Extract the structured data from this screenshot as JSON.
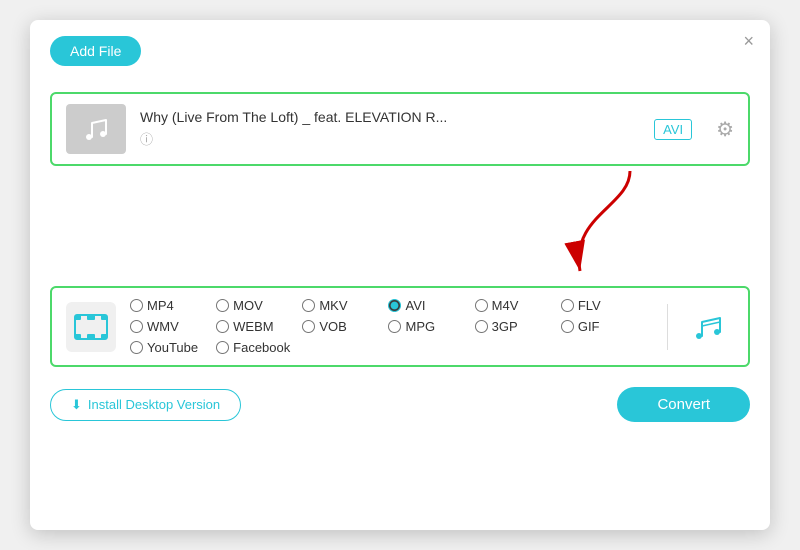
{
  "dialog": {
    "close_label": "×",
    "add_file_label": "Add File",
    "install_label": "Install Desktop Version",
    "convert_label": "Convert"
  },
  "file": {
    "title": "Why (Live From The Loft) _ feat. ELEVATION R...",
    "format": "AVI"
  },
  "formats": {
    "row1": [
      "MP4",
      "MOV",
      "MKV",
      "AVI",
      "M4V",
      "FLV",
      "WMV"
    ],
    "row2": [
      "WEBM",
      "VOB",
      "MPG",
      "3GP",
      "GIF",
      "YouTube",
      "Facebook"
    ],
    "selected": "AVI"
  },
  "icons": {
    "music_note": "♪",
    "gear": "⚙",
    "info": "ⓘ",
    "download": "⬇",
    "film": "🎞",
    "audio_note": "♫"
  }
}
